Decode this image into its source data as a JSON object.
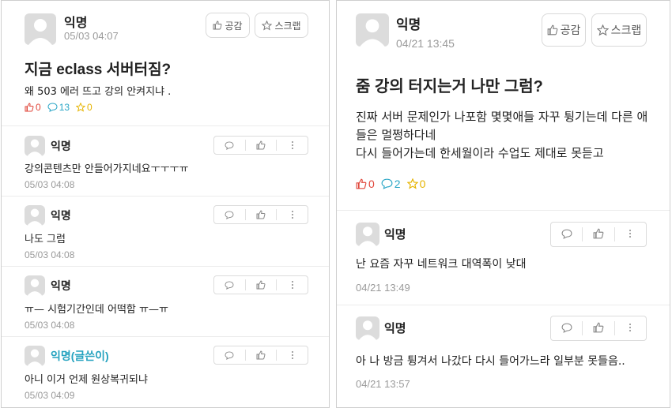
{
  "left": {
    "post": {
      "author": "익명",
      "time": "05/03 04:07",
      "title": "지금 eclass 서버터짐?",
      "body": "왜 503 에러 뜨고 강의 안켜지냐 .",
      "like_label": "공감",
      "scrap_label": "스크랩",
      "likes": "0",
      "comments": "13",
      "scraps": "0"
    },
    "comments": [
      {
        "author": "익명",
        "text": "강의콘텐츠만 안들어가지네요ㅜㅜㅜㅠ",
        "time": "05/03 04:08"
      },
      {
        "author": "익명",
        "text": "나도 그럼",
        "time": "05/03 04:08"
      },
      {
        "author": "익명",
        "text": "ㅠ— 시험기간인데 어떡함 ㅠ—ㅠ",
        "time": "05/03 04:08"
      },
      {
        "author": "익명(글쓴이)",
        "text": "아니 이거 언제 원상복귀되냐",
        "time": "05/03 04:09"
      }
    ]
  },
  "right": {
    "post": {
      "author": "익명",
      "time": "04/21 13:45",
      "title": "줌 강의 터지는거 나만 그럼?",
      "body_line1": "진짜 서버 문제인가 나포함 몇몇애들 자꾸 튕기는데 다른 애",
      "body_line2": "들은 멀쩡하다네",
      "body_line3": "다시 들어가는데 한세월이라 수업도 제대로 못듣고",
      "like_label": "공감",
      "scrap_label": "스크랩",
      "likes": "0",
      "comments": "2",
      "scraps": "0"
    },
    "comments": [
      {
        "author": "익명",
        "text": "난 요즘 자꾸 네트워크 대역폭이 낮대",
        "time": "04/21 13:49"
      },
      {
        "author": "익명",
        "text": "아 나 방금 튕겨서 나갔다 다시 들어가느라 일부분 못들음..",
        "time": "04/21 13:57"
      }
    ]
  },
  "icons": {
    "like": "thumbs-up-icon",
    "scrap": "star-icon",
    "comment": "speech-bubble-icon",
    "more": "more-vertical-icon"
  },
  "colors": {
    "like": "#e0463a",
    "comment": "#2aa6c6",
    "scrap": "#e6b400",
    "op_author": "#24a2bf"
  }
}
